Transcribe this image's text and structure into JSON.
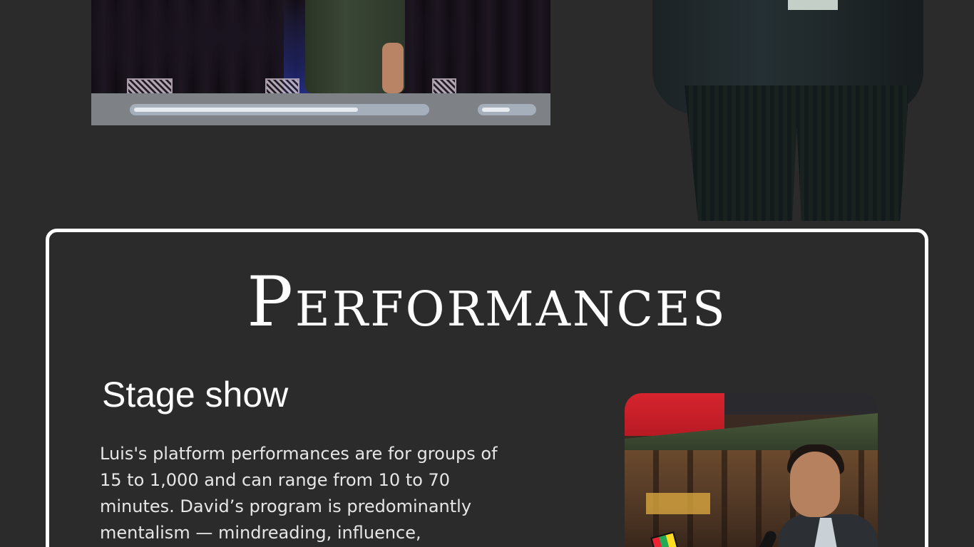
{
  "video_player": {
    "progress": 0.77,
    "volume": 0.55
  },
  "performances": {
    "title": "Performances",
    "stage_show": {
      "heading": "Stage show",
      "body": "Luis's platform performances are for groups of 15 to 1,000 and can range from 10 to 70 minutes. David’s program is predominantly mentalism — mindreading, influence,"
    }
  },
  "colors": {
    "background": "#2b2b2b",
    "card_border": "#ffffff",
    "text": "#ffffff",
    "body_text": "#e6e6e6",
    "video_controls_bg": "#7e8186",
    "progress_track": "#a5afbb",
    "progress_fill": "#e8ecf0"
  }
}
